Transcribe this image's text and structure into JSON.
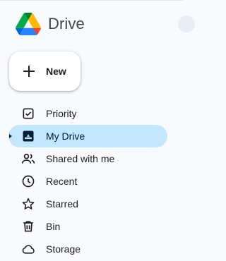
{
  "app": {
    "name": "Drive",
    "logo": "google-drive-logo"
  },
  "new_button": {
    "label": "New",
    "icon": "plus-icon"
  },
  "nav": {
    "items": [
      {
        "label": "Priority",
        "icon": "priority-check-icon",
        "active": false
      },
      {
        "label": "My Drive",
        "icon": "my-drive-icon",
        "active": true,
        "expandable": true
      },
      {
        "label": "Shared with me",
        "icon": "people-icon",
        "active": false
      },
      {
        "label": "Recent",
        "icon": "clock-icon",
        "active": false
      },
      {
        "label": "Starred",
        "icon": "star-icon",
        "active": false
      },
      {
        "label": "Bin",
        "icon": "trash-icon",
        "active": false
      },
      {
        "label": "Storage",
        "icon": "cloud-icon",
        "active": false
      }
    ]
  },
  "colors": {
    "background": "#f8fafd",
    "active_highlight": "#c2e7ff",
    "text": "#1f1f1f",
    "brand_text": "#444746"
  }
}
